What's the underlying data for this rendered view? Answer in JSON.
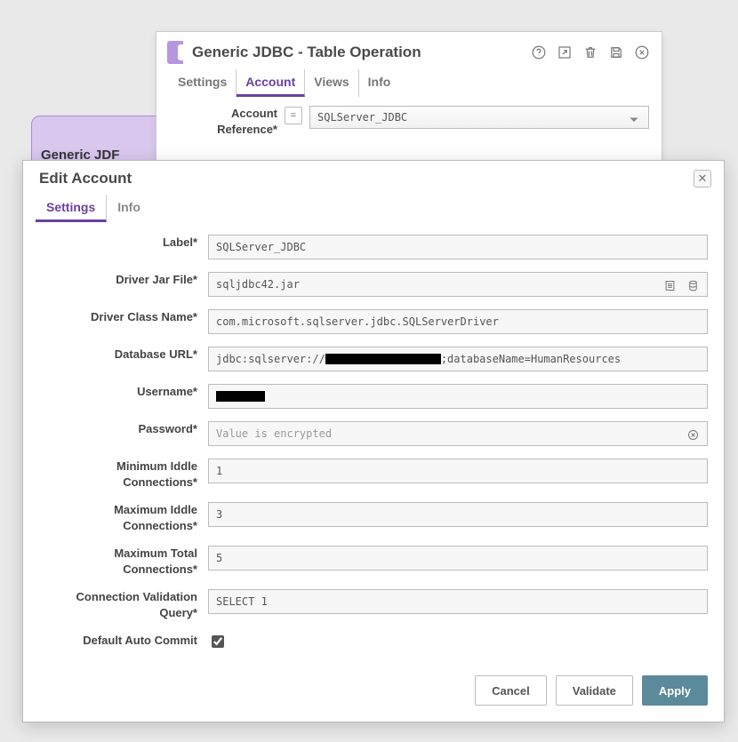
{
  "bg_box": {
    "label": "Generic JDF"
  },
  "back_panel": {
    "title": "Generic JDBC - Table Operation",
    "tabs": [
      "Settings",
      "Account",
      "Views",
      "Info"
    ],
    "active_tab": 1,
    "account_ref_label": "Account Reference*",
    "eq": "=",
    "account_ref_value": "SQLServer_JDBC"
  },
  "modal": {
    "title": "Edit Account",
    "tabs": [
      "Settings",
      "Info"
    ],
    "active_tab": 0,
    "fields": {
      "label": {
        "label": "Label*",
        "value": "SQLServer_JDBC"
      },
      "driver_jar": {
        "label": "Driver Jar File*",
        "value": "sqljdbc42.jar"
      },
      "driver_class": {
        "label": "Driver Class Name*",
        "value": "com.microsoft.sqlserver.jdbc.SQLServerDriver"
      },
      "db_url": {
        "label": "Database URL*",
        "prefix": "jdbc:sqlserver://",
        "suffix": ";databaseName=HumanResources"
      },
      "username": {
        "label": "Username*"
      },
      "password": {
        "label": "Password*",
        "placeholder": "Value is encrypted"
      },
      "min_idle": {
        "label": "Minimum Iddle Connections*",
        "value": "1"
      },
      "max_idle": {
        "label": "Maximum Iddle Connections*",
        "value": "3"
      },
      "max_total": {
        "label": "Maximum Total Connections*",
        "value": "5"
      },
      "validation": {
        "label": "Connection Validation Query*",
        "value": "SELECT 1"
      },
      "auto_commit": {
        "label": "Default Auto Commit",
        "checked": true
      }
    },
    "buttons": {
      "cancel": "Cancel",
      "validate": "Validate",
      "apply": "Apply"
    }
  }
}
